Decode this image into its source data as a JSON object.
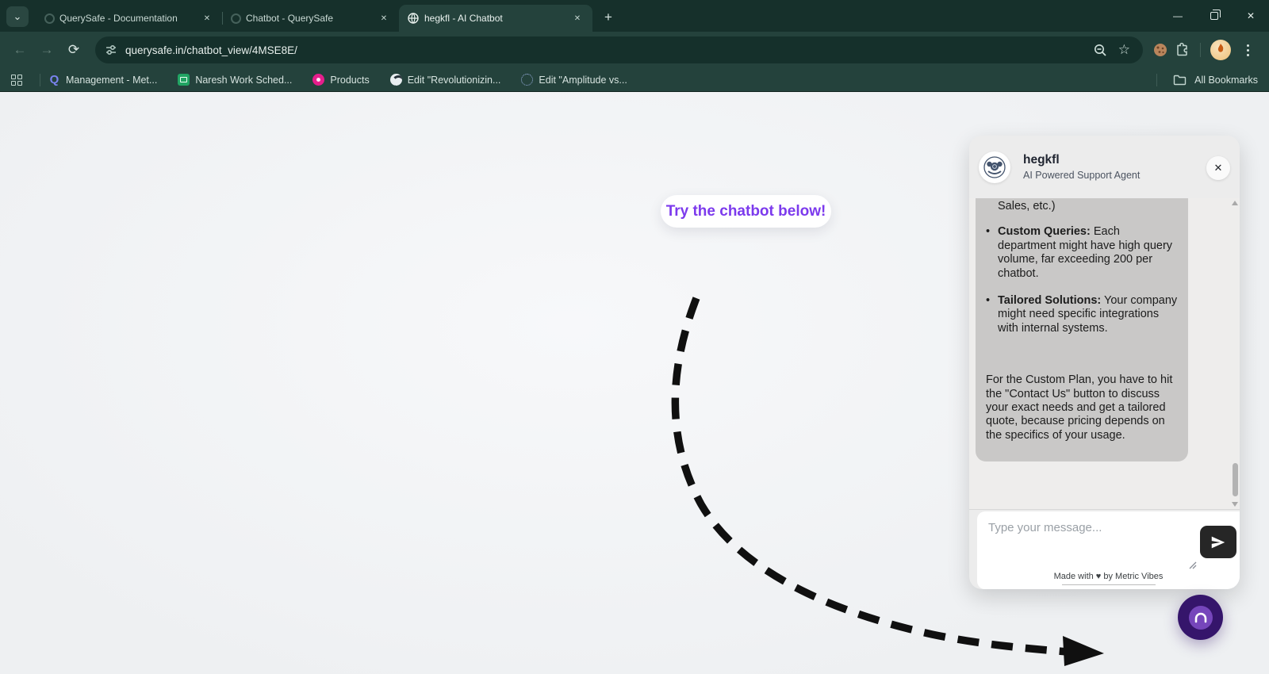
{
  "browser": {
    "tabs": [
      {
        "title": "QuerySafe - Documentation",
        "active": false
      },
      {
        "title": "Chatbot - QuerySafe",
        "active": false
      },
      {
        "title": "hegkfl - AI Chatbot",
        "active": true
      }
    ],
    "url": "querysafe.in/chatbot_view/4MSE8E/",
    "bookmarks": [
      "Management - Met...",
      "Naresh Work Sched...",
      "Products",
      "Edit \"Revolutionizin...",
      "Edit \"Amplitude vs..."
    ],
    "all_bookmarks_label": "All Bookmarks"
  },
  "icons": {
    "tab_search": "⌄",
    "tab_close": "✕",
    "new_tab": "+",
    "minimize": "—",
    "window_close": "✕",
    "back": "←",
    "forward": "→",
    "reload": "⟳",
    "star": "☆",
    "bookmark_q": "Q",
    "chat_close": "✕"
  },
  "page": {
    "callout": "Try the chatbot below!"
  },
  "chat": {
    "title": "hegkfl",
    "subtitle": "AI Powered Support Agent",
    "message": {
      "intro_fragment": "Sales, etc.)",
      "bullets": [
        {
          "lead": "Custom Queries:",
          "text": " Each department might have high query volume, far exceeding 200 per chatbot."
        },
        {
          "lead": "Tailored Solutions:",
          "text": " Your company might need specific integrations with internal systems."
        }
      ],
      "paragraph": "For the Custom Plan, you have to hit the \"Contact Us\" button to discuss your exact needs and get a tailored quote, because pricing depends on the specifics of your usage."
    },
    "input_placeholder": "Type your message...",
    "footer": "Made with ♥ by Metric Vibes"
  },
  "colors": {
    "accent_purple": "#7c3aed",
    "chrome_theme": "#24423c",
    "chrome_frame": "#16302b",
    "bubble_gray": "#c9c8c7",
    "send_button": "#262626",
    "fab_purple": "#35156b"
  }
}
